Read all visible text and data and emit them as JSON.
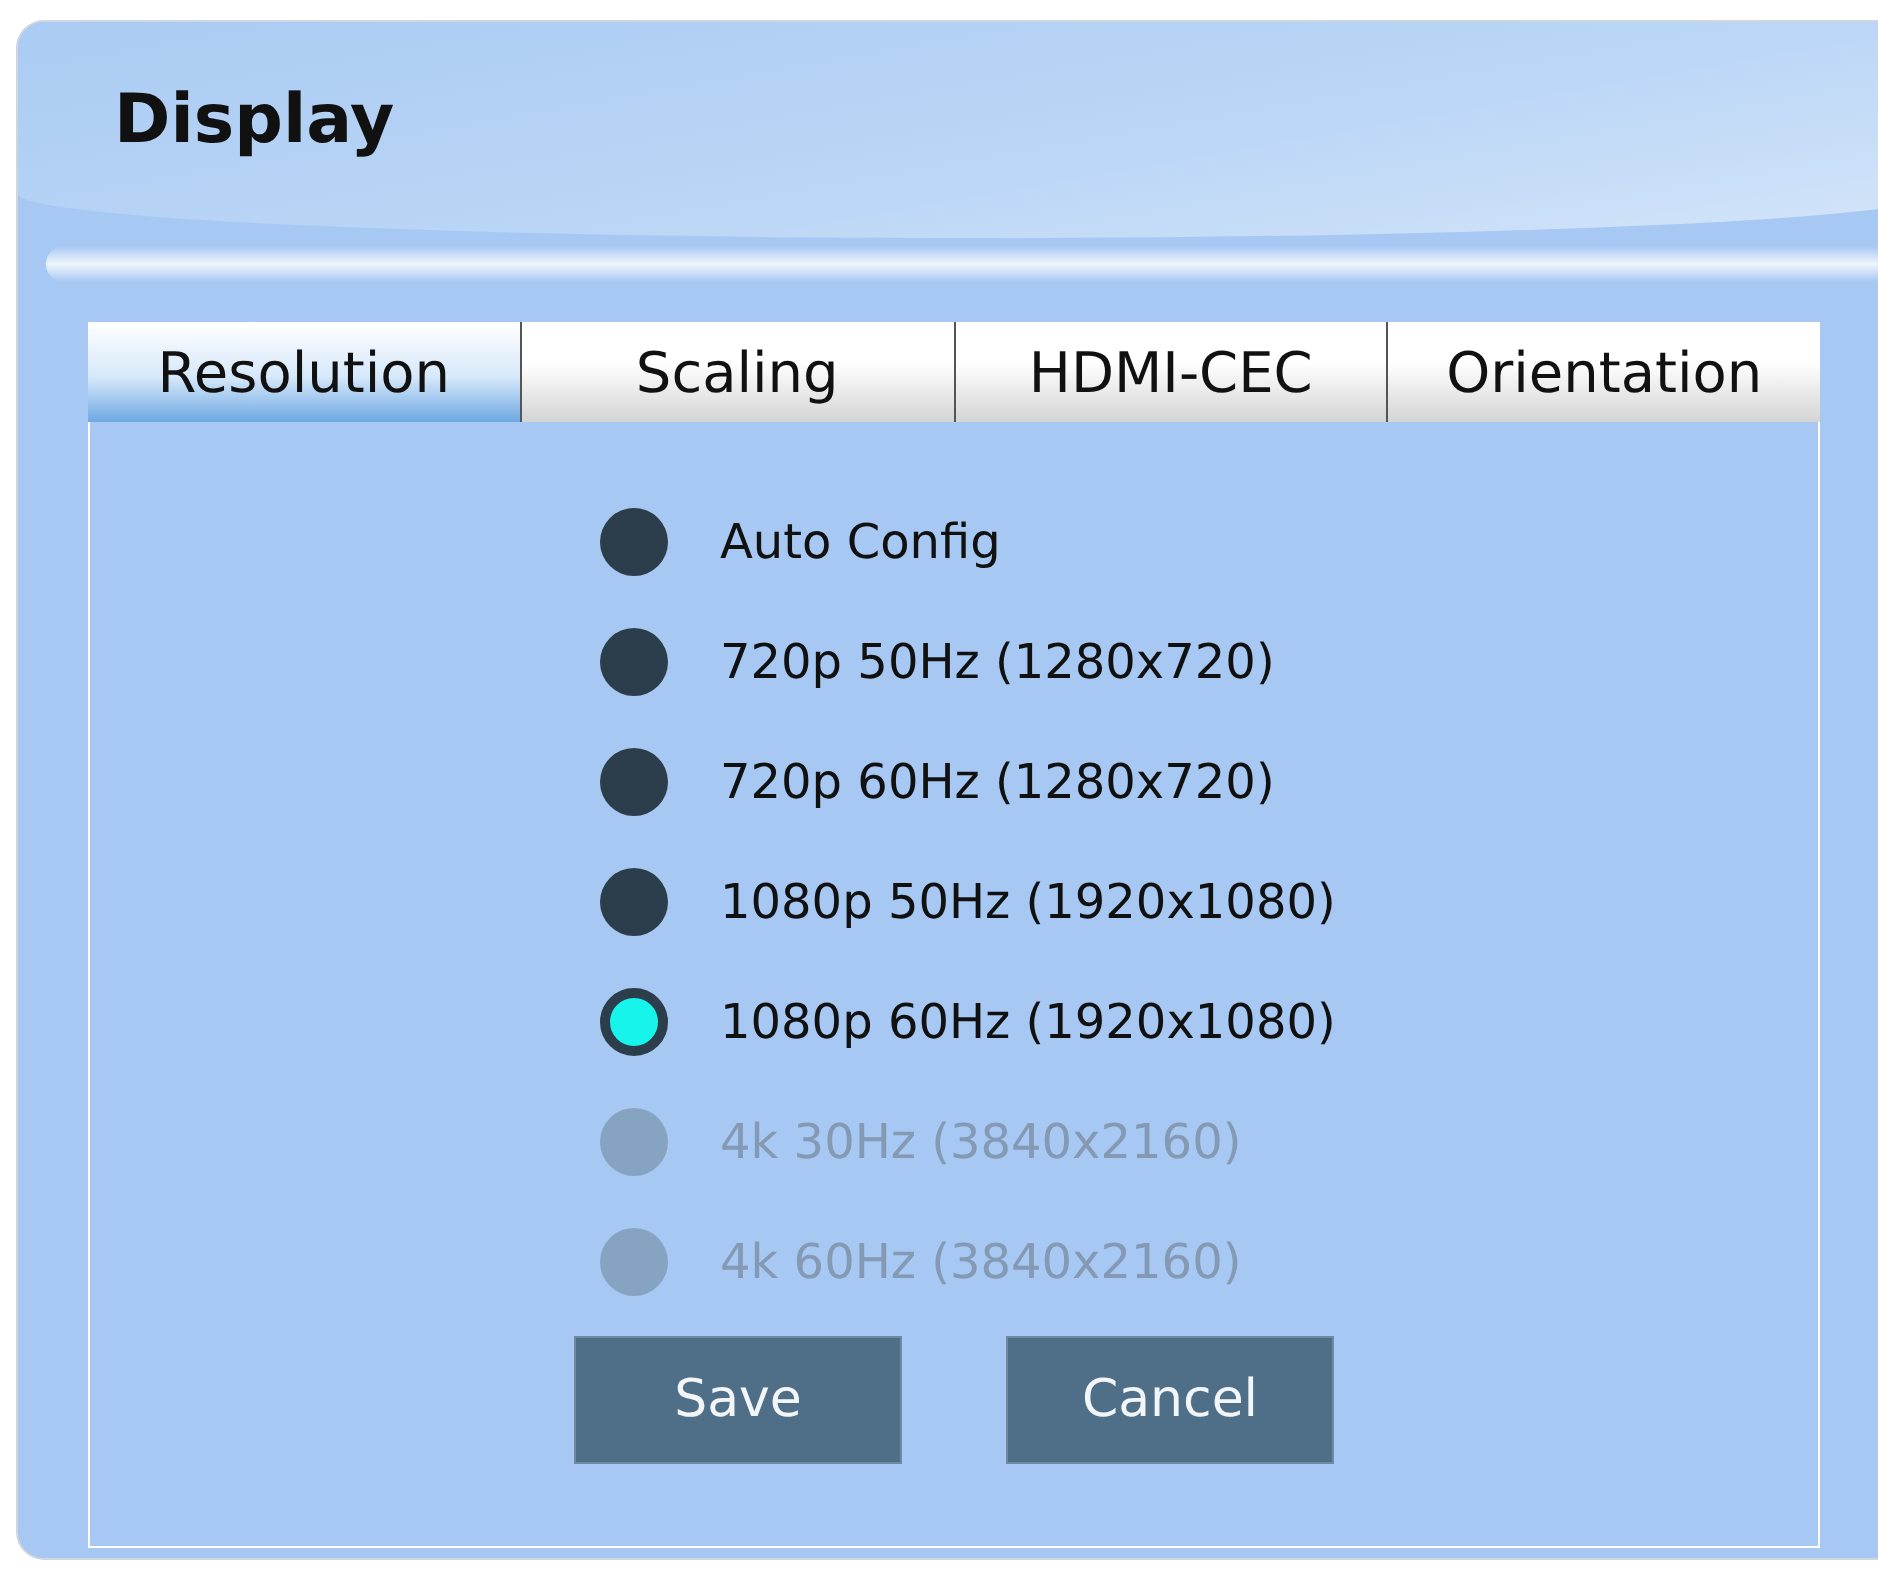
{
  "window": {
    "title": "Display"
  },
  "tabs": [
    {
      "label": "Resolution",
      "selected": true
    },
    {
      "label": "Scaling",
      "selected": false
    },
    {
      "label": "HDMI-CEC",
      "selected": false
    },
    {
      "label": "Orientation",
      "selected": false
    }
  ],
  "options": [
    {
      "label": "Auto Config",
      "selected": false,
      "disabled": false
    },
    {
      "label": "720p 50Hz (1280x720)",
      "selected": false,
      "disabled": false
    },
    {
      "label": "720p 60Hz (1280x720)",
      "selected": false,
      "disabled": false
    },
    {
      "label": "1080p 50Hz (1920x1080)",
      "selected": false,
      "disabled": false
    },
    {
      "label": "1080p 60Hz (1920x1080)",
      "selected": true,
      "disabled": false
    },
    {
      "label": "4k 30Hz (3840x2160)",
      "selected": false,
      "disabled": true
    },
    {
      "label": "4k 60Hz (3840x2160)",
      "selected": false,
      "disabled": true
    }
  ],
  "buttons": [
    "Save",
    "Cancel"
  ]
}
